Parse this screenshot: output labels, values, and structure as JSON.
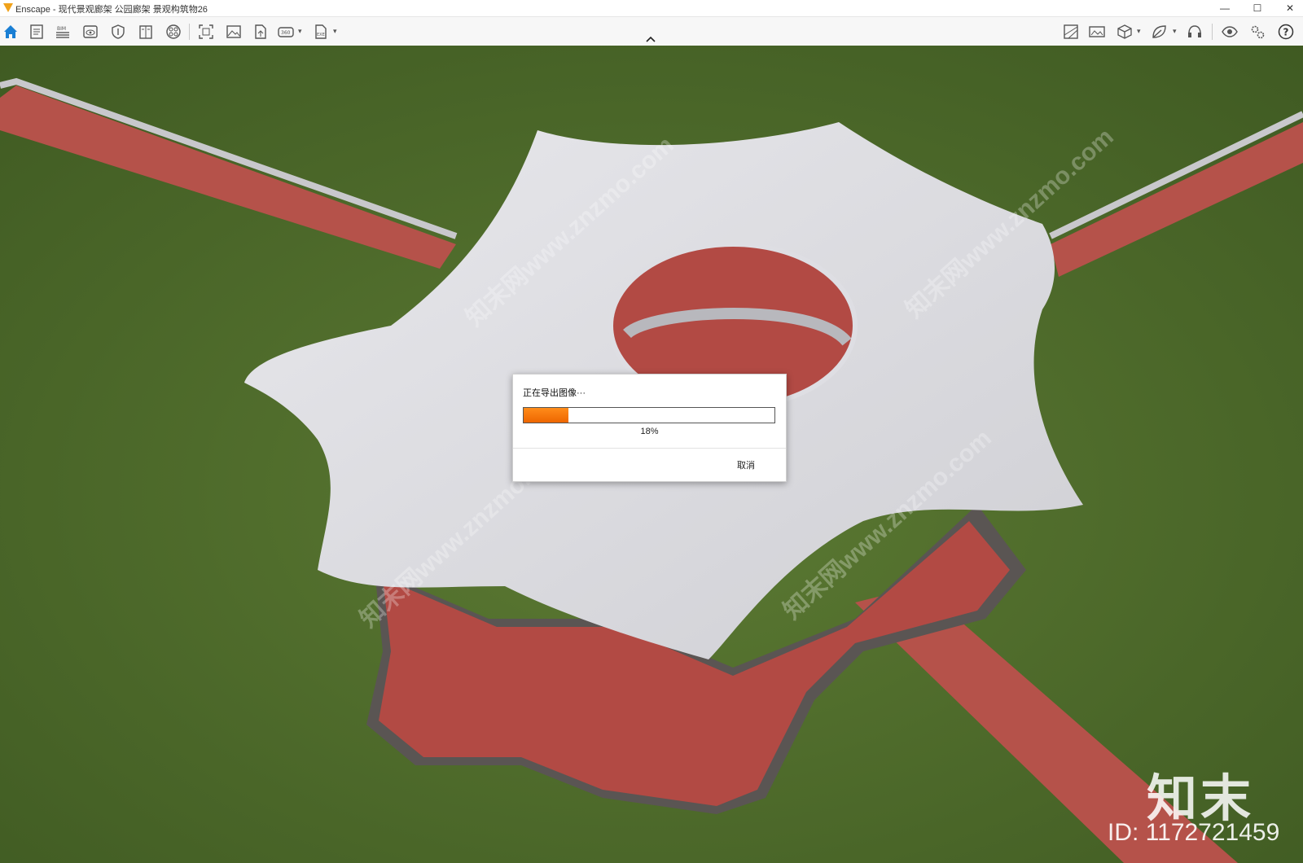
{
  "window": {
    "title": "Enscape - 现代景观廊架 公园廊架 景观构筑物26",
    "minimize_glyph": "—",
    "maximize_glyph": "☐",
    "close_glyph": "✕"
  },
  "toolbar": {
    "left_icons": [
      "home-icon",
      "document-icon",
      "bim-icon",
      "view-icon",
      "shield-icon",
      "book-icon",
      "materials-icon",
      "screenshot-icon",
      "image-icon",
      "export-icon",
      "vr-360-icon",
      "export-file-icon"
    ],
    "right_icons": [
      "map-icon",
      "panorama-icon",
      "cube-icon",
      "leaf-icon",
      "headset-icon",
      "eye-icon",
      "settings-icon",
      "help-icon"
    ],
    "bim_label": "BIM",
    "vr_label": "360",
    "exe_label": "EXE",
    "help_glyph": "?"
  },
  "viewport": {
    "watermark_text": "知末网www.znzmo.com",
    "brand_logo": "知末",
    "brand_id": "ID: 1172721459"
  },
  "dialog": {
    "title": "正在导出图像···",
    "progress": 0.18,
    "progress_label": "18%",
    "cancel_label": "取消",
    "accent_color": "#ff7a00"
  }
}
